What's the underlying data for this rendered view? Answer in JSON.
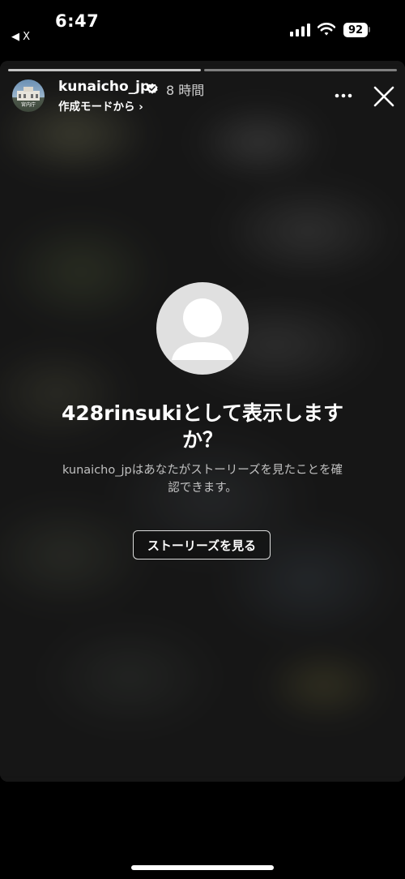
{
  "status_bar": {
    "time": "6:47",
    "back_app": "◀ X",
    "battery": "92",
    "icons": [
      "signal-icon",
      "wifi-icon",
      "battery-icon"
    ]
  },
  "story": {
    "progress_segments": 2,
    "current_segment": 1,
    "header": {
      "username": "kunaicho_jp",
      "verified": true,
      "time_ago": "8 時間",
      "subline": "作成モードから ›",
      "avatar_text": "宮内庁"
    },
    "prompt": {
      "title": "428rinsukiとして表示しますか？",
      "description": "kunaicho_jpはあなたがストーリーズを見たことを確認できます。",
      "button": "ストーリーズを見る"
    }
  }
}
